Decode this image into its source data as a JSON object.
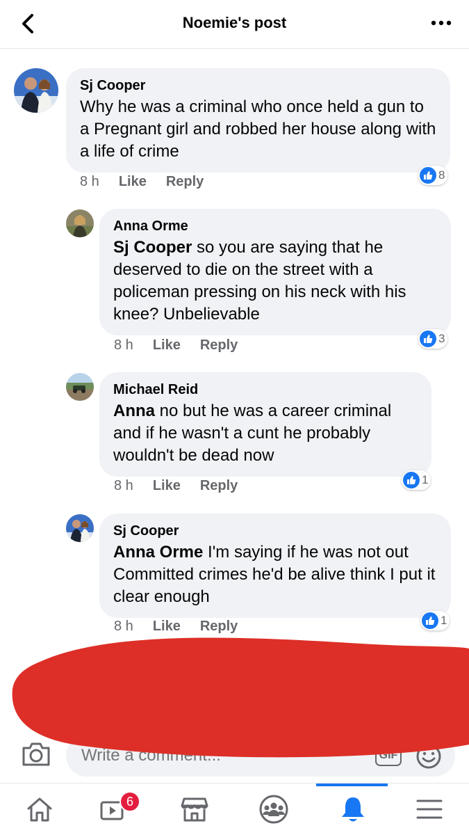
{
  "header": {
    "title": "Noemie's post",
    "back_icon": "chevron-left-icon",
    "more_icon": "ellipsis-icon"
  },
  "comments": [
    {
      "author": "Sj Cooper",
      "mention": "",
      "text": "Why he was a criminal who once held a gun to a Pregnant girl and robbed her house along with a life of crime",
      "time": "8 h",
      "like_label": "Like",
      "reply_label": "Reply",
      "reactions": "8"
    },
    {
      "author": "Anna Orme",
      "mention": "Sj Cooper",
      "text": " so you are saying that he deserved to die on the street with a policeman pressing on his neck with his knee? Unbelievable",
      "time": "8 h",
      "like_label": "Like",
      "reply_label": "Reply",
      "reactions": "3"
    },
    {
      "author": "Michael Reid",
      "mention": "Anna",
      "text": " no but he was a career criminal and if he wasn't a cunt he probably wouldn't be dead now",
      "time": "8 h",
      "like_label": "Like",
      "reply_label": "Reply",
      "reactions": "1"
    },
    {
      "author": "Sj Cooper",
      "mention": "Anna Orme",
      "text": " I'm saying if he was not out Committed crimes he'd be alive think I put it clear enough",
      "time": "8 h",
      "like_label": "Like",
      "reply_label": "Reply",
      "reactions": "1"
    }
  ],
  "composer": {
    "placeholder": "Write a comment...",
    "gif_label": "GIF"
  },
  "tabbar": {
    "video_badge": "6",
    "active": "notifications"
  },
  "colors": {
    "accent": "#1877f2",
    "bubble": "#f0f2f5",
    "meta": "#65676b",
    "redaction": "#dd2f27",
    "badge": "#e41e3f"
  }
}
